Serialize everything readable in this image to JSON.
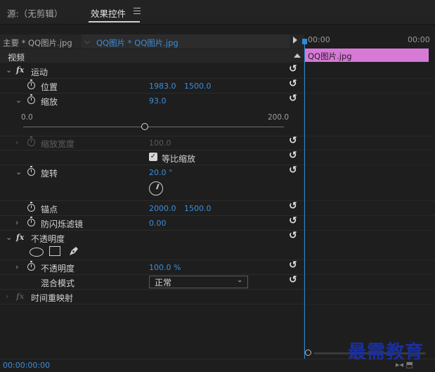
{
  "tabs": {
    "source": "源:（无剪辑）",
    "effect_controls": "效果控件"
  },
  "clip_header": {
    "source_clip": "主要 * QQ图片.jpg",
    "sequence_clip": "QQ图片 * QQ图片.jpg"
  },
  "section": {
    "video": "视频"
  },
  "motion": {
    "label": "运动",
    "position": {
      "label": "位置",
      "x": "1983.0",
      "y": "1500.0"
    },
    "scale": {
      "label": "缩放",
      "value": "93.0",
      "slider_min": "0.0",
      "slider_max": "200.0",
      "slider_level": 0.465
    },
    "scale_width": {
      "label": "缩放宽度",
      "value": "100.0"
    },
    "uniform_scale": {
      "label": "等比缩放",
      "checked": true
    },
    "rotation": {
      "label": "旋转",
      "value": "20.0 °"
    },
    "anchor": {
      "label": "锚点",
      "x": "2000.0",
      "y": "1500.0"
    },
    "anti_flicker": {
      "label": "防闪烁滤镜",
      "value": "0.00"
    }
  },
  "opacity_effect": {
    "label": "不透明度",
    "opacity": {
      "label": "不透明度",
      "value": "100.0 %"
    },
    "blend_mode": {
      "label": "混合模式",
      "value": "正常"
    }
  },
  "time_remap": {
    "label": "时间重映射"
  },
  "timeline": {
    "start_tc": "00:00",
    "end_tc": "00:00",
    "clip_label": "QQ图片.jpg"
  },
  "footer": {
    "timecode": "00:00:00:00"
  },
  "watermark": "最需教育",
  "colors": {
    "accent_blue": "#3b8edb",
    "clip_pink": "#d67ad6",
    "watermark_blue": "#1a2f9e"
  }
}
